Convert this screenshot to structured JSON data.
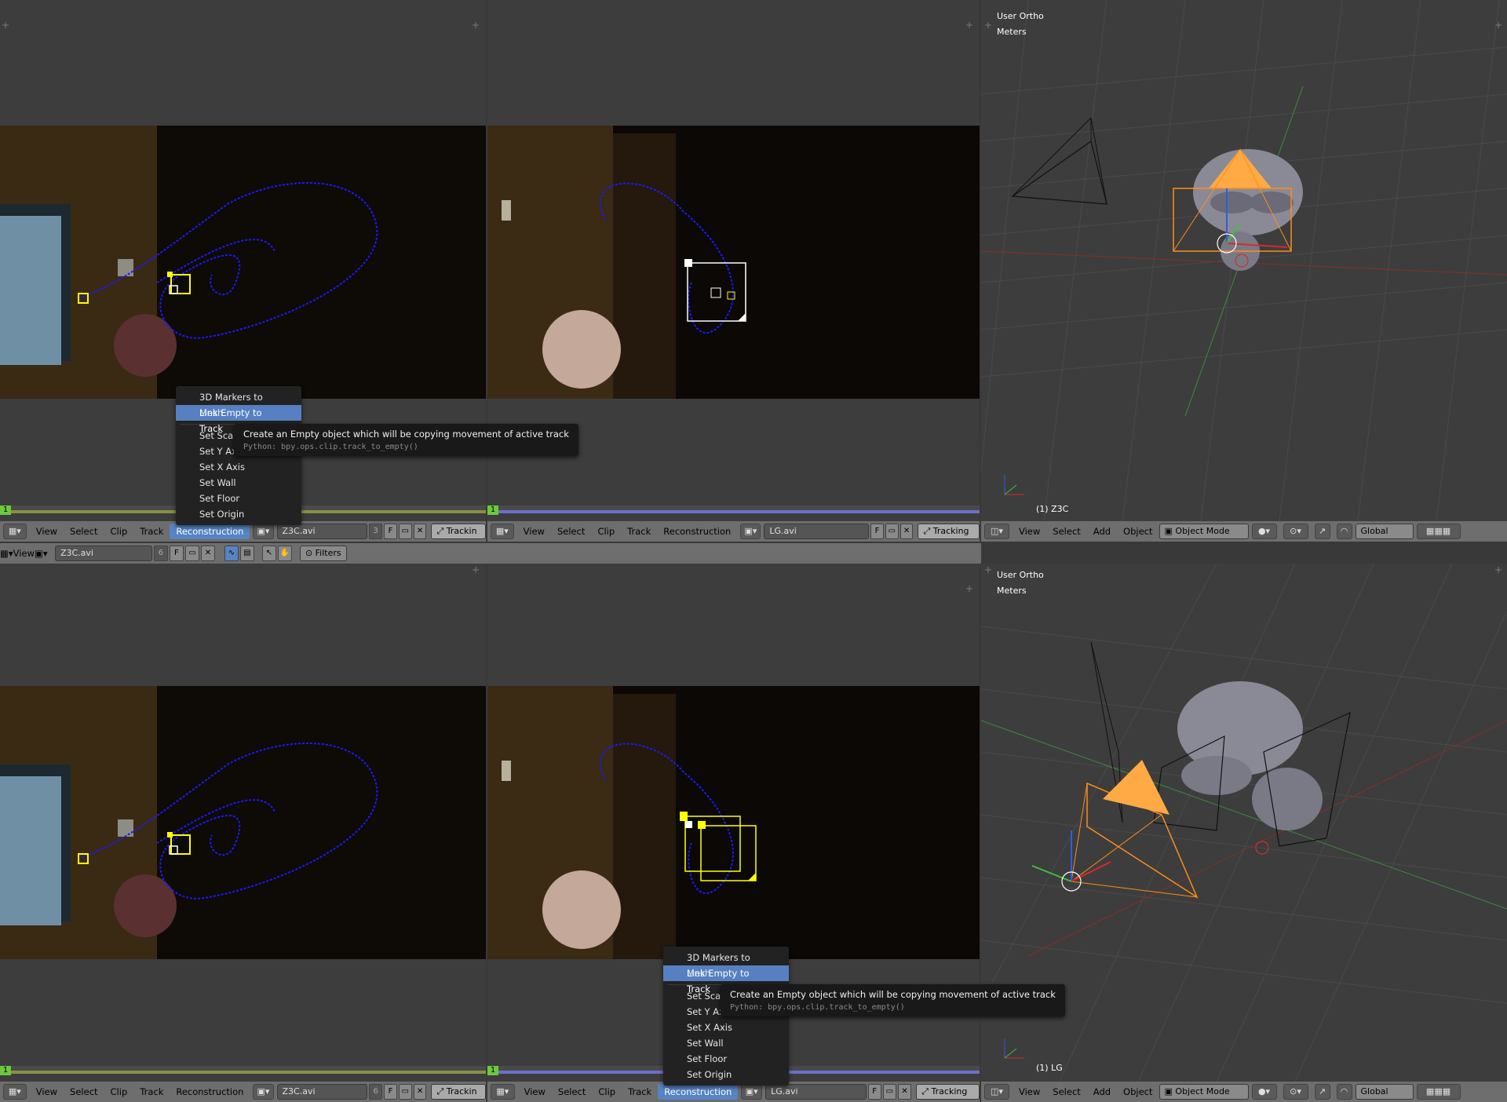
{
  "clip_header_top_left": {
    "menus": [
      "View",
      "Select",
      "Clip",
      "Track",
      "Reconstruction"
    ],
    "active_menu": "Reconstruction",
    "clip_name": "Z3C.avi",
    "users": "3",
    "fake_user": "F",
    "mode": "Trackin"
  },
  "clip_header_top_mid": {
    "menus": [
      "View",
      "Select",
      "Clip",
      "Track",
      "Reconstruction"
    ],
    "clip_name": "LG.avi",
    "fake_user": "F",
    "mode": "Tracking"
  },
  "clip_header_bot_left": {
    "menus": [
      "View",
      "Select",
      "Clip",
      "Track",
      "Reconstruction"
    ],
    "clip_name": "Z3C.avi",
    "users": "6",
    "fake_user": "F",
    "mode": "Trackin"
  },
  "clip_header_bot_mid": {
    "menus": [
      "View",
      "Select",
      "Clip",
      "Track",
      "Reconstruction"
    ],
    "active_menu": "Reconstruction",
    "clip_name": "LG.avi",
    "fake_user": "F",
    "mode": "Tracking"
  },
  "dopesheet_header": {
    "view": "View",
    "clip_name": "Z3C.avi",
    "users": "6",
    "fake_user": "F",
    "filters": "Filters"
  },
  "view3d_top": {
    "overlay_title": "User Ortho",
    "units": "Meters",
    "object_label": "(1) Z3C",
    "menus": [
      "View",
      "Select",
      "Add",
      "Object"
    ],
    "mode": "Object Mode",
    "orientation": "Global"
  },
  "view3d_bottom": {
    "overlay_title": "User Ortho",
    "units": "Meters",
    "object_label": "(1) LG",
    "menus": [
      "View",
      "Select",
      "Add",
      "Object"
    ],
    "mode": "Object Mode",
    "orientation": "Global"
  },
  "reconstruction_menu": {
    "items": [
      "3D Markers to Mesh",
      "Link Empty to Track",
      "Set Scale",
      "Set Y Axis",
      "Set X Axis",
      "Set Wall",
      "Set Floor",
      "Set Origin"
    ],
    "highlighted": "Link Empty to Track",
    "visible_top": [
      "3D Markers to Mesh",
      "Link Empty to Track",
      "Set Scale",
      "Set Y Axi",
      "Set X Axis",
      "Set Wall",
      "Set Floor",
      "Set Origin"
    ],
    "visible_bottom": [
      "3D Markers to Mesh",
      "Link Empty to Track",
      "Set Scal",
      "Set Y Ax",
      "Set X Axis",
      "Set Wall",
      "Set Floor",
      "Set Origin"
    ]
  },
  "tooltip": {
    "text": "Create an Empty object which will be copying movement of active track",
    "python": "Python: bpy.ops.clip.track_to_empty()"
  },
  "frame_number": "1",
  "colors": {
    "track_path": "#1a1aff",
    "marker_selected": "#ffff00",
    "menu_highlight": "#5680c2",
    "camera_selected": "#ff8c1a",
    "axis_x": "#d42b2b",
    "axis_y": "#3ec23e",
    "axis_z": "#2b5fe0"
  }
}
